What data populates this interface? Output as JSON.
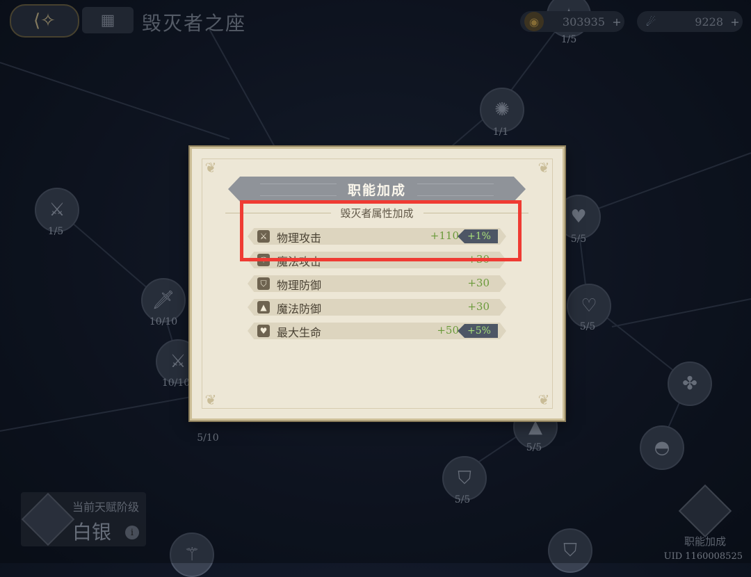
{
  "header": {
    "title": "毁灭者之座",
    "currencies": [
      {
        "icon": "gold-coin-icon",
        "value": "303935",
        "plus": "+"
      },
      {
        "icon": "crystal-icon",
        "value": "9228",
        "plus": "+"
      }
    ]
  },
  "nodes": [
    {
      "label": "1/5"
    },
    {
      "label": "1/1"
    },
    {
      "label": "1/5"
    },
    {
      "label": "10/10"
    },
    {
      "label": "10/10"
    },
    {
      "label": "5/10"
    },
    {
      "label": "5/5"
    },
    {
      "label": "5/5"
    },
    {
      "label": "5/5"
    },
    {
      "label": "5/5"
    }
  ],
  "rank_panel": {
    "caption": "当前天赋阶级",
    "value": "白银",
    "info": "i"
  },
  "job_bonus_button": {
    "label": "职能加成"
  },
  "uid": "UID 1160008525",
  "dialog": {
    "title": "职能加成",
    "subtitle": "毁灭者属性加成",
    "stats": [
      {
        "icon": "sword-icon",
        "name": "物理攻击",
        "value": "+110",
        "percent": "+1%"
      },
      {
        "icon": "magic-wand-icon",
        "name": "魔法攻击",
        "value": "+30",
        "percent": ""
      },
      {
        "icon": "shield-icon",
        "name": "物理防御",
        "value": "+30",
        "percent": ""
      },
      {
        "icon": "wizard-hat-icon",
        "name": "魔法防御",
        "value": "+30",
        "percent": ""
      },
      {
        "icon": "heart-icon",
        "name": "最大生命",
        "value": "+50",
        "percent": "+5%"
      }
    ]
  },
  "colors": {
    "accent_highlight": "#ef3b33",
    "stat_value_green": "#6a9a3a",
    "percent_badge_bg": "#4d5665"
  }
}
